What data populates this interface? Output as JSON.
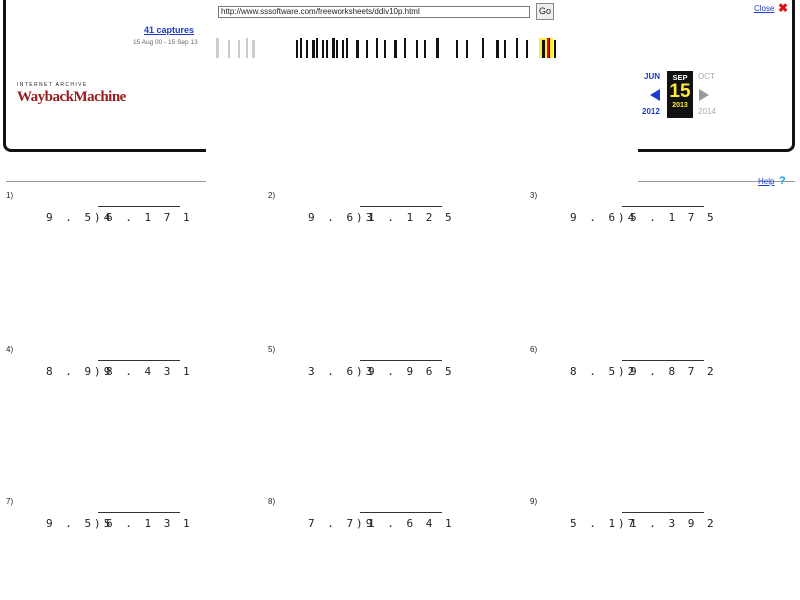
{
  "toolbar": {
    "url": "http://www.sssoftware.com/freeworksheets/ddiv10p.html",
    "go_label": "Go",
    "captures_label": "41 captures",
    "captures_range": "15 Aug 00 - 15 Sep 13",
    "logo_small": "INTERNET ARCHIVE",
    "logo_big": "WaybackMachine",
    "close_label": "Close",
    "help_label": "Help",
    "calendar": {
      "prev_month": "JUN",
      "current_month": "SEP",
      "next_month": "OCT",
      "current_day": "15",
      "prev_year": "2012",
      "current_year": "2013",
      "next_year": "2014"
    }
  },
  "colors": {
    "link": "#1a3ccc",
    "logo": "#9a1c20",
    "highlight": "#ffeb3b",
    "close": "#dd1111"
  },
  "problems": [
    {
      "num": "1)",
      "divisor": "9.54",
      "dividend": "6.171"
    },
    {
      "num": "2)",
      "divisor": "9.63",
      "dividend": "1.125"
    },
    {
      "num": "3)",
      "divisor": "9.64",
      "dividend": "5.175"
    },
    {
      "num": "4)",
      "divisor": "8.99",
      "dividend": "8.431"
    },
    {
      "num": "5)",
      "divisor": "3.63",
      "dividend": "9.965"
    },
    {
      "num": "6)",
      "divisor": "8.52",
      "dividend": "9.872"
    },
    {
      "num": "7)",
      "divisor": "9.55",
      "dividend": "6.131"
    },
    {
      "num": "8)",
      "divisor": "7.79",
      "dividend": "1.641"
    },
    {
      "num": "9)",
      "divisor": "5.17",
      "dividend": "1.392"
    }
  ]
}
